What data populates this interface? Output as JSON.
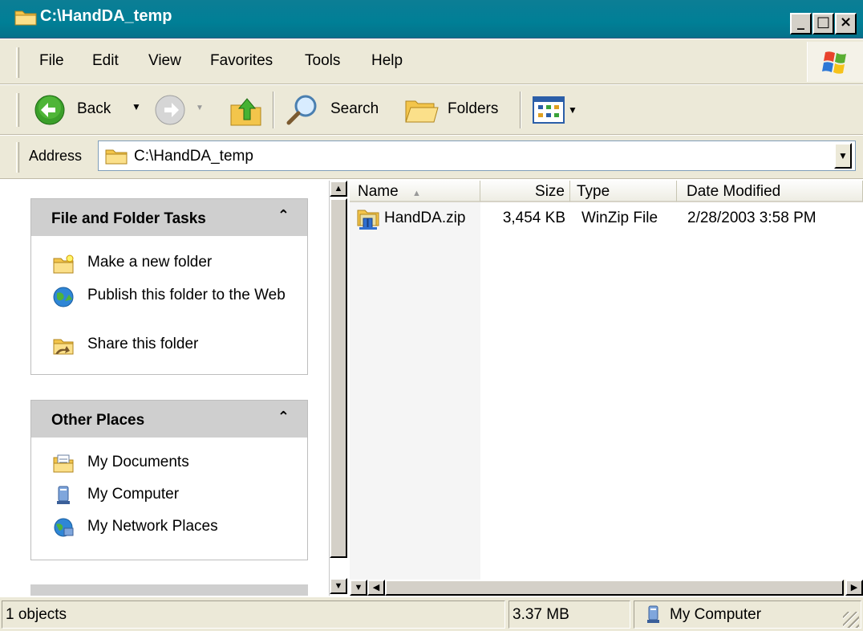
{
  "window": {
    "title": "C:\\HandDA_temp",
    "minimize_label": "_",
    "maximize_label": "□",
    "close_label": "×"
  },
  "menu": {
    "file": "File",
    "edit": "Edit",
    "view": "View",
    "favorites": "Favorites",
    "tools": "Tools",
    "help": "Help"
  },
  "toolbar": {
    "back_label": "Back",
    "search_label": "Search",
    "folders_label": "Folders"
  },
  "address": {
    "label": "Address",
    "value": "C:\\HandDA_temp"
  },
  "tasks": {
    "title": "File and Folder Tasks",
    "items": [
      {
        "label": "Make a new folder",
        "icon": "new-folder-icon"
      },
      {
        "label": "Publish this folder to the Web",
        "icon": "publish-web-icon"
      },
      {
        "label": "Share this folder",
        "icon": "share-folder-icon"
      }
    ]
  },
  "other_places": {
    "title": "Other Places",
    "items": [
      {
        "label": "My Documents",
        "icon": "my-documents-icon"
      },
      {
        "label": "My Computer",
        "icon": "my-computer-icon"
      },
      {
        "label": "My Network Places",
        "icon": "network-places-icon"
      }
    ]
  },
  "file_list": {
    "columns": {
      "name": "Name",
      "size": "Size",
      "type": "Type",
      "date": "Date Modified"
    },
    "rows": [
      {
        "name": "HandDA.zip",
        "size": "3,454 KB",
        "type": "WinZip File",
        "date": "2/28/2003 3:58 PM"
      }
    ]
  },
  "status": {
    "objects": "1 objects",
    "size": "3.37 MB",
    "location": "My Computer"
  },
  "colors": {
    "title_bar": "#007f96",
    "chrome": "#ece9d8",
    "task_header": "#cfcfcf"
  }
}
